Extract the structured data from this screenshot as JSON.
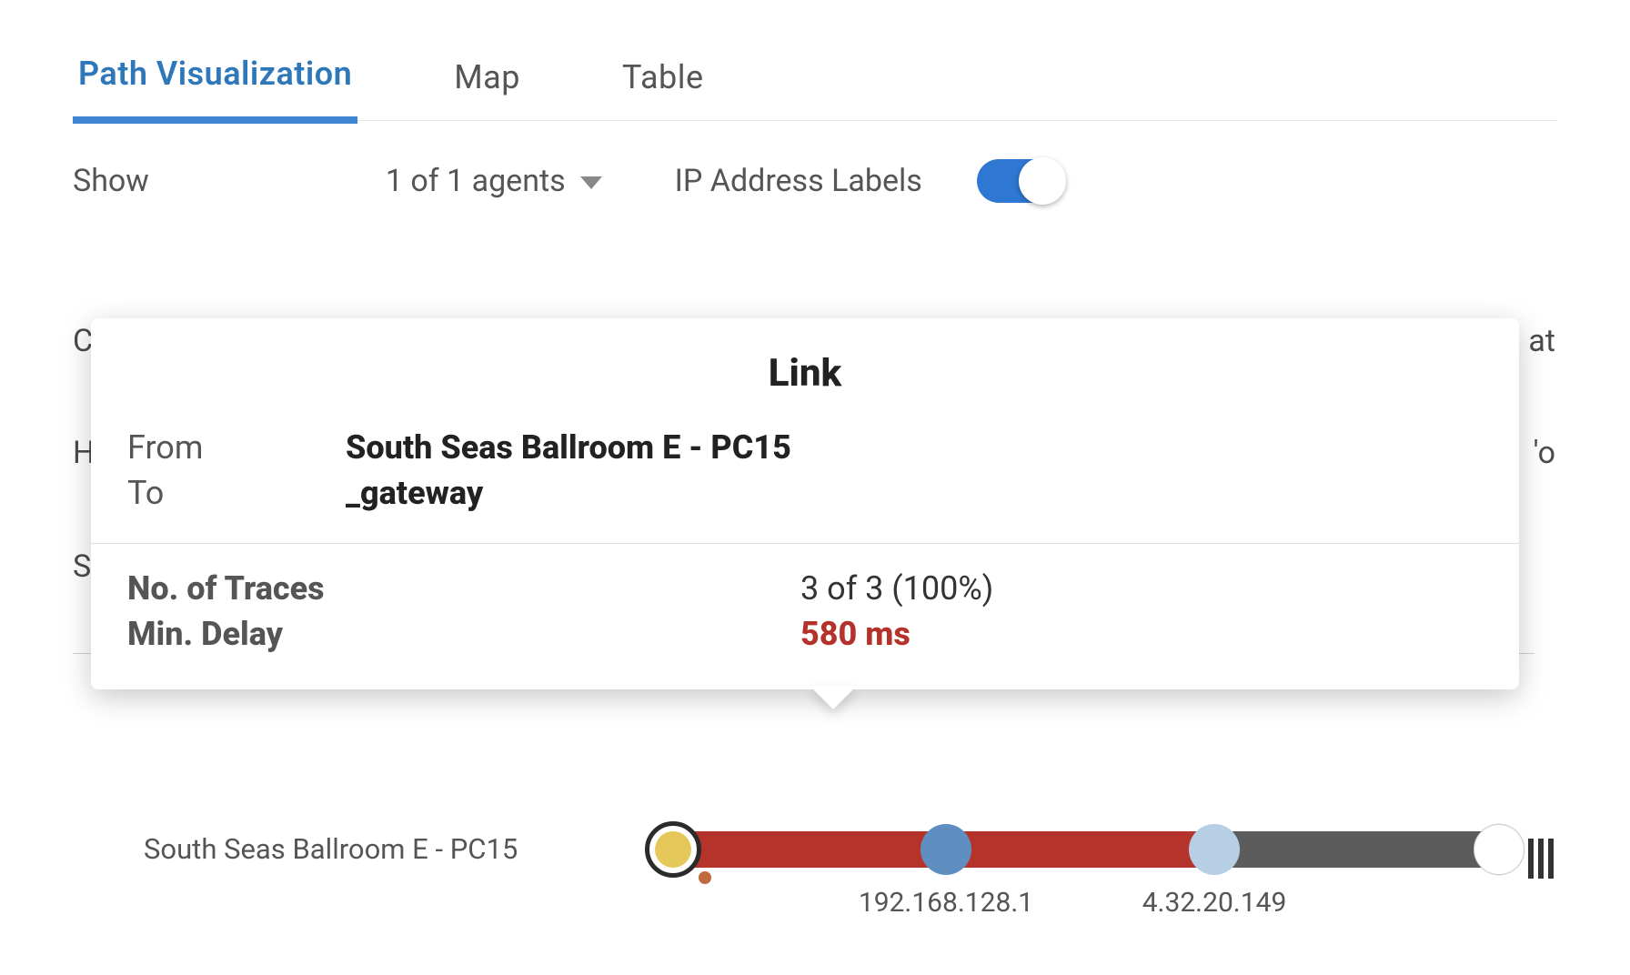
{
  "tabs": {
    "path_visualization": "Path Visualization",
    "map": "Map",
    "table": "Table"
  },
  "controls": {
    "show_label": "Show",
    "agent_dropdown": "1 of 1 agents",
    "ip_labels_label": "IP Address Labels",
    "ip_labels_on": true
  },
  "bg": {
    "r1_left": "C",
    "r1_right": "at",
    "r2_left": "H",
    "r2_right": "'o",
    "r3_left": "S"
  },
  "tooltip": {
    "title": "Link",
    "from_label": "From",
    "from_value": "South Seas Ballroom E - PC15",
    "to_label": "To",
    "to_value": "_gateway",
    "traces_label": "No. of Traces",
    "traces_value": "3 of 3 (100%)",
    "delay_label": "Min. Delay",
    "delay_value": "580 ms"
  },
  "path": {
    "source_label": "South Seas Ballroom E - PC15",
    "hop1_ip": "192.168.128.1",
    "hop2_ip": "4.32.20.149"
  }
}
